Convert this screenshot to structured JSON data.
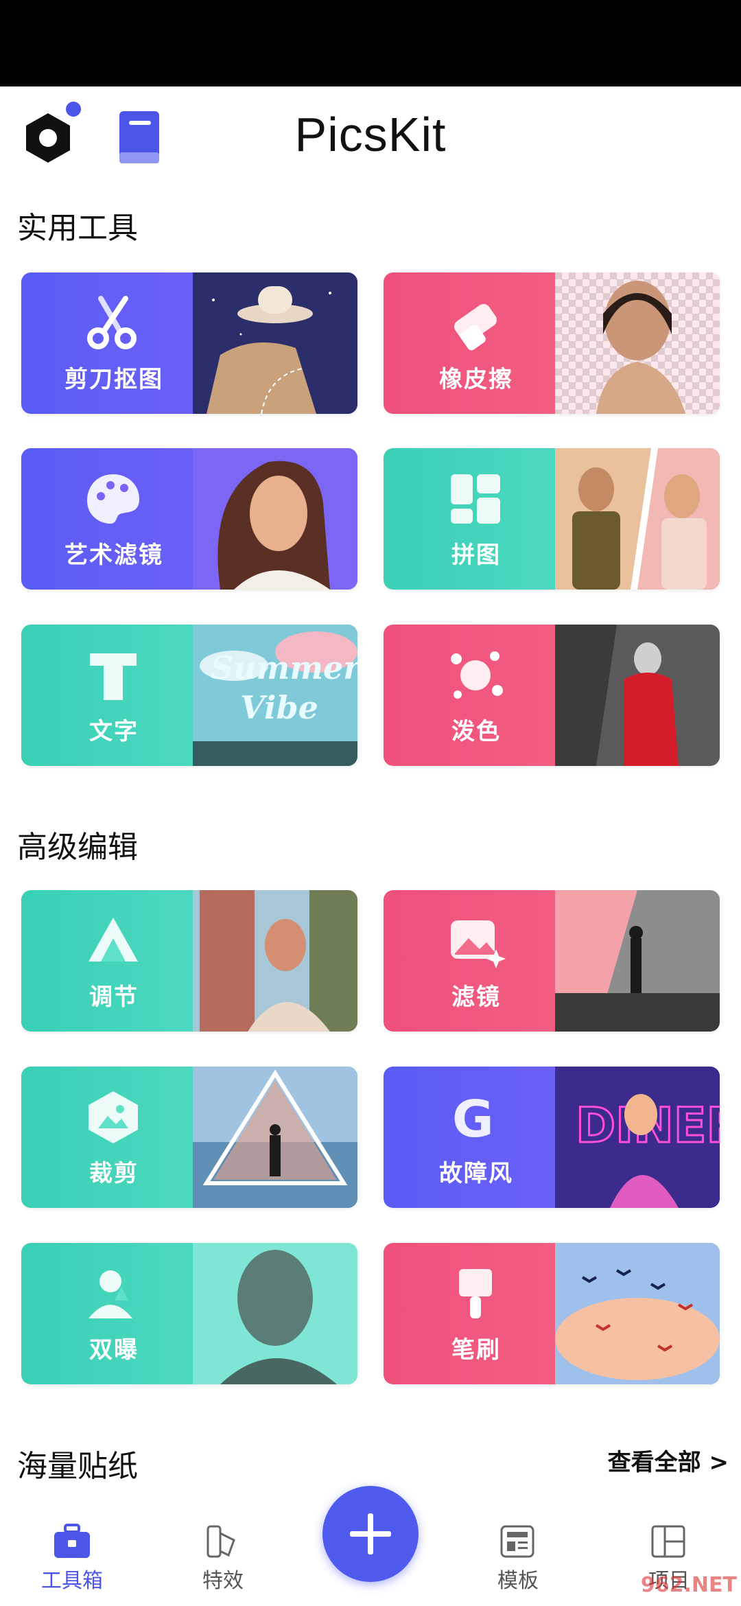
{
  "app": {
    "title": "PicsKit"
  },
  "sections": {
    "tools": "实用工具",
    "advanced": "高级编辑",
    "stickers": "海量贴纸",
    "see_all": "查看全部 >"
  },
  "tool_cards": [
    {
      "label": "剪刀抠图",
      "icon": "scissors-icon",
      "color": "#5a5cf6"
    },
    {
      "label": "橡皮擦",
      "icon": "eraser-icon",
      "color": "#f0507a"
    },
    {
      "label": "艺术滤镜",
      "icon": "palette-icon",
      "color": "#5a5cf6"
    },
    {
      "label": "拼图",
      "icon": "collage-icon",
      "color": "#39d0b5"
    },
    {
      "label": "文字",
      "icon": "text-icon",
      "color": "#39d0b5",
      "photo_text": "Summer Vibe"
    },
    {
      "label": "泼色",
      "icon": "splash-icon",
      "color": "#f0507a"
    }
  ],
  "advanced_cards": [
    {
      "label": "调节",
      "icon": "adjust-icon",
      "color": "#39d0b5"
    },
    {
      "label": "滤镜",
      "icon": "filter-icon",
      "color": "#f0507a"
    },
    {
      "label": "裁剪",
      "icon": "crop-icon",
      "color": "#39d0b5"
    },
    {
      "label": "故障风",
      "icon": "glitch-icon",
      "color": "#5a5cf6"
    },
    {
      "label": "双曝",
      "icon": "double-exposure-icon",
      "color": "#39d0b5"
    },
    {
      "label": "笔刷",
      "icon": "brush-icon",
      "color": "#f0507a"
    }
  ],
  "bottom_nav": [
    {
      "label": "工具箱",
      "icon": "toolbox-icon",
      "active": true
    },
    {
      "label": "特效",
      "icon": "effects-icon",
      "active": false
    },
    {
      "label": "模板",
      "icon": "template-icon",
      "active": false
    },
    {
      "label": "项目",
      "icon": "project-icon",
      "active": false
    }
  ],
  "watermark": "962.NET"
}
